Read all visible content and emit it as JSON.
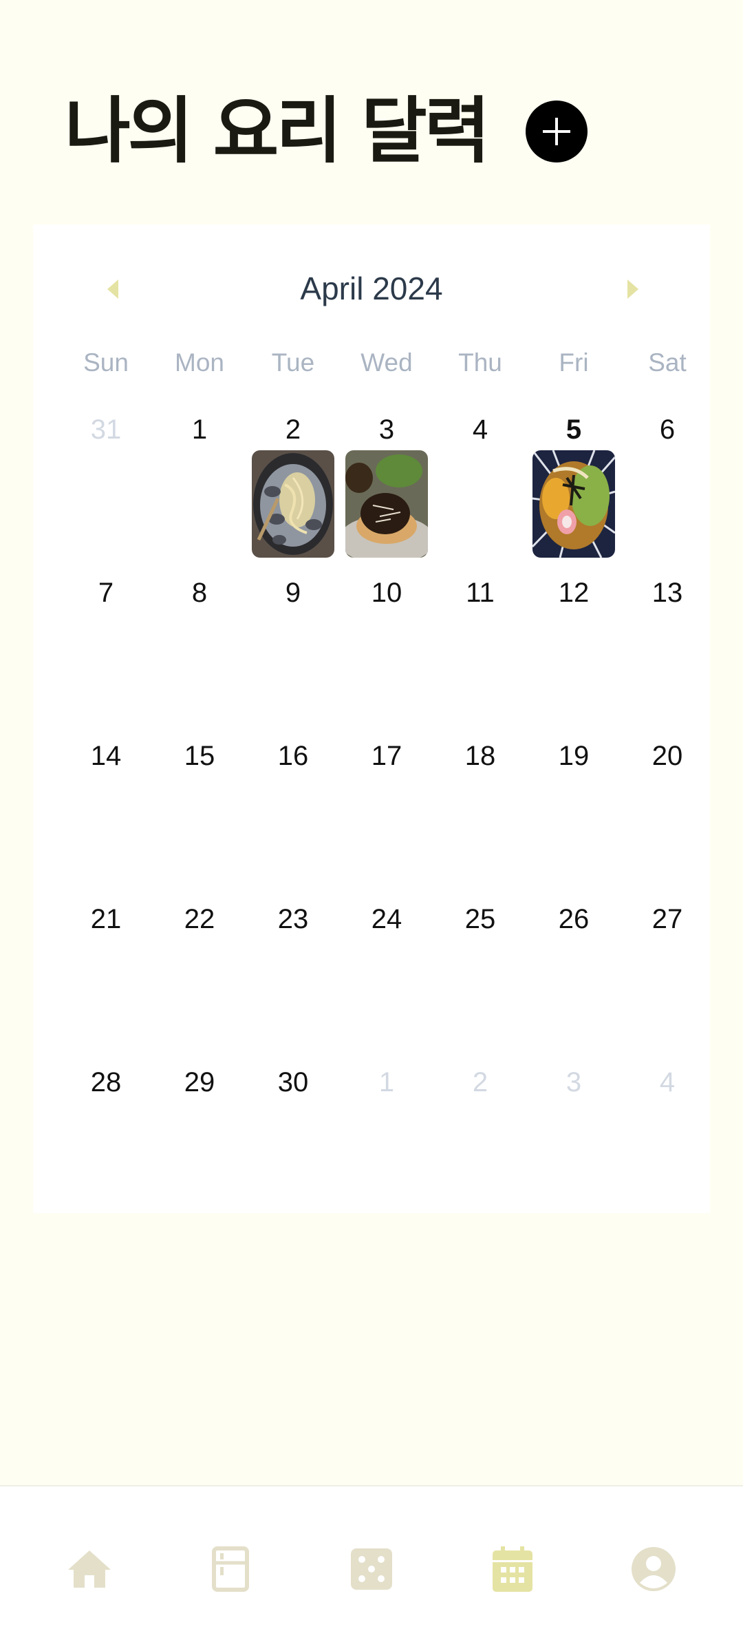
{
  "header": {
    "title": "나의 요리 달력",
    "add_icon": "plus-icon"
  },
  "calendar": {
    "month_label": "April 2024",
    "prev_icon": "caret-left-icon",
    "next_icon": "caret-right-icon",
    "weekdays": [
      "Sun",
      "Mon",
      "Tue",
      "Wed",
      "Thu",
      "Fri",
      "Sat"
    ],
    "weeks": [
      [
        "31",
        "1",
        "2",
        "3",
        "4",
        "5",
        "6"
      ],
      [
        "7",
        "8",
        "9",
        "10",
        "11",
        "12",
        "13"
      ],
      [
        "14",
        "15",
        "16",
        "17",
        "18",
        "19",
        "20"
      ],
      [
        "21",
        "22",
        "23",
        "24",
        "25",
        "26",
        "27"
      ],
      [
        "28",
        "29",
        "30",
        "1",
        "2",
        "3",
        "4"
      ]
    ],
    "today": "5",
    "photos": [
      {
        "day": "2",
        "dish": "clam-pasta-photo"
      },
      {
        "day": "3",
        "dish": "bruschetta-photo"
      },
      {
        "day": "5",
        "dish": "ramen-bowl-photo"
      }
    ]
  },
  "bottom_nav": {
    "tabs": [
      {
        "icon": "home-icon",
        "active": false
      },
      {
        "icon": "fridge-icon",
        "active": false
      },
      {
        "icon": "dice-icon",
        "active": false
      },
      {
        "icon": "calendar-icon",
        "active": true
      },
      {
        "icon": "user-icon",
        "active": false
      }
    ]
  },
  "colors": {
    "background": "#FFFEF2",
    "accent": "#E5E3A3",
    "inactive_icon": "#E3DFC9",
    "title": "#1A1A12"
  }
}
